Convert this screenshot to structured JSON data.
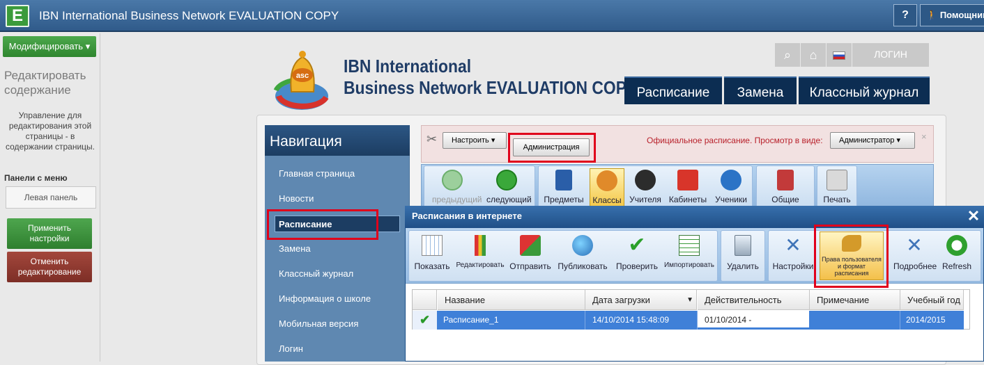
{
  "app": {
    "title": "IBN International Business Network EVALUATION COPY",
    "logo_letter": "E",
    "help_label": "?",
    "helper_label": "Помощник"
  },
  "edit_panel": {
    "modify_label": "Модифицировать",
    "title": "Редактировать содержание",
    "description": "Управление для редактирования этой страницы - в содержании страницы.",
    "menu_panels_label": "Панели с меню",
    "left_panel_button": "Левая панель",
    "apply_label": "Применить настройки",
    "cancel_label": "Отменить редактирование"
  },
  "site": {
    "title_line1": "IBN International",
    "title_line2": "Business Network EVALUATION COPY",
    "login_label": "ЛОГИН",
    "tabs": [
      "Расписание",
      "Замена",
      "Классный журнал"
    ]
  },
  "navigation": {
    "heading": "Навигация",
    "items": [
      "Главная страница",
      "Новости",
      "Расписание",
      "Замена",
      "Классный журнал",
      "Информация о школе",
      "Мобильная версия",
      "Логин"
    ]
  },
  "admin_bar": {
    "configure_label": "Настроить",
    "admin_label": "Администрация",
    "status_text": "Официальное расписание.  Просмотр в виде:",
    "view_as_value": "Администратор",
    "close": "×"
  },
  "toolbar": {
    "buttons": [
      "предыдущий",
      "следующий",
      "Предметы",
      "Классы",
      "Учителя",
      "Кабинеты",
      "Ученики",
      "Общие",
      "Печать"
    ]
  },
  "dialog": {
    "title": "Расписания в интернете",
    "close": "✕",
    "buttons": [
      "Показать",
      "Редактировать",
      "Отправить",
      "Публиковать",
      "Проверить",
      "Импортировать",
      "Удалить",
      "Настройки",
      "Права пользователя и формат расписания",
      "Подробнее",
      "Refresh"
    ]
  },
  "table": {
    "headers": [
      "Название",
      "Дата загрузки",
      "Действительность",
      "Примечание",
      "Учебный год"
    ],
    "rows": [
      {
        "check": "✔",
        "name": "Расписание_1",
        "uploaded": "14/10/2014 15:48:09",
        "validity": "01/10/2014 -",
        "note": "",
        "year": "2014/2015"
      }
    ]
  },
  "colors": {
    "accent_blue": "#1f4f87",
    "highlight_red": "#e0001b",
    "nav_blue": "#5f88b1",
    "selected_row": "#3f80d8"
  }
}
